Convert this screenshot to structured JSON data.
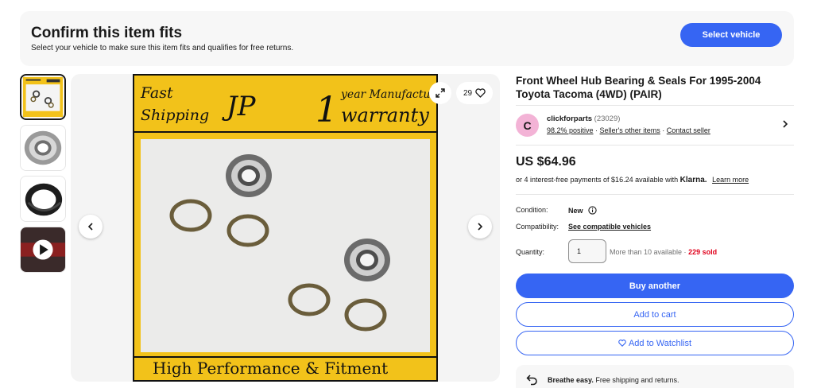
{
  "fit_banner": {
    "title": "Confirm this item fits",
    "subtitle": "Select your vehicle to make sure this item fits and qualifies for free returns.",
    "button": "Select vehicle"
  },
  "gallery": {
    "thumbnails": [
      "thumbnail-product-collage",
      "thumbnail-wheel-bearing",
      "thumbnail-oil-seal",
      "thumbnail-video"
    ],
    "image_text": {
      "fast": "Fast",
      "shipping": "Shipping",
      "logo": "JP",
      "one": "1",
      "year_manufacture": "year Manufacture",
      "warranty": "warranty",
      "footer": "High Performance & Fitment"
    },
    "watch_count": "29"
  },
  "item": {
    "title": "Front Wheel Hub Bearing & Seals For 1995-2004 Toyota Tacoma (4WD) (PAIR)",
    "price": "US $64.96",
    "klarna_prefix": "or 4 interest-free payments of $16.24 available with",
    "klarna_brand": "Klarna.",
    "klarna_learn": "Learn more"
  },
  "seller": {
    "initial": "C",
    "name": "clickforparts",
    "count": "(23029)",
    "positive": "98.2% positive",
    "other_items": "Seller's other items",
    "contact": "Contact seller"
  },
  "details": {
    "condition_label": "Condition:",
    "condition_value": "New",
    "compat_label": "Compatibility:",
    "compat_link": "See compatible vehicles",
    "qty_label": "Quantity:",
    "qty_value": "1",
    "qty_avail": "More than 10 available ·",
    "qty_sold": "229 sold"
  },
  "actions": {
    "buy": "Buy another",
    "cart": "Add to cart",
    "watch": "Add to Watchlist"
  },
  "breathe": {
    "bold": "Breathe easy.",
    "text": "Free shipping and returns."
  },
  "colors": {
    "primary": "#3665f3",
    "sold": "#e0001b",
    "banner_yellow": "#f2c21a"
  }
}
